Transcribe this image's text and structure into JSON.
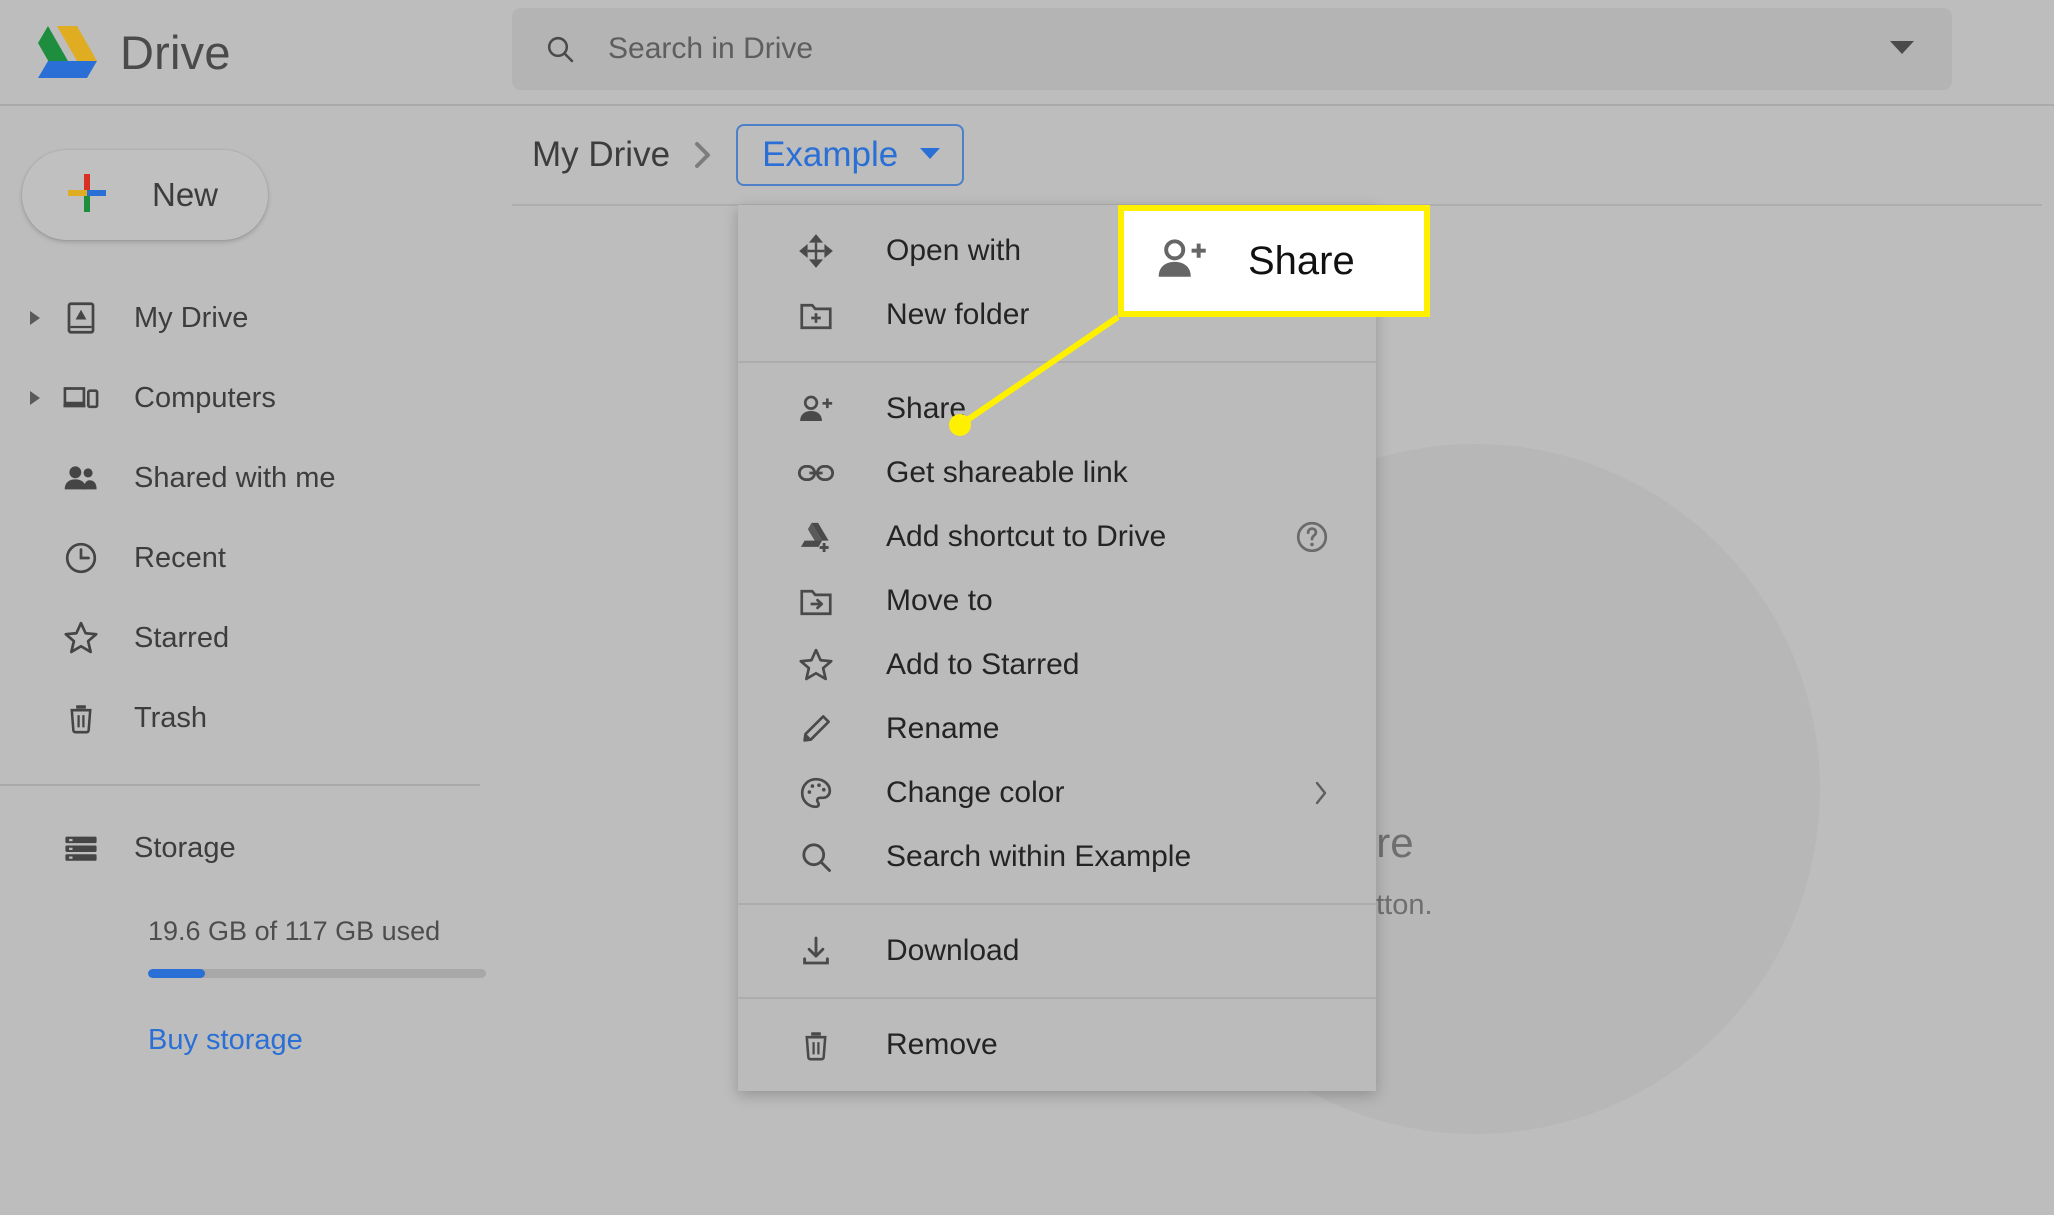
{
  "app": {
    "name": "Drive",
    "logo_colors": {
      "green": "#1e8e3e",
      "yellow": "#e0ac21",
      "blue": "#2a6fd6"
    }
  },
  "search": {
    "placeholder": "Search in Drive",
    "value": "",
    "icon": "search-icon",
    "options_icon": "chevron-down-icon"
  },
  "sidebar": {
    "new_button": {
      "label": "New",
      "icon": "plus-icon"
    },
    "items": [
      {
        "label": "My Drive",
        "icon": "drive-document-icon",
        "expandable": true
      },
      {
        "label": "Computers",
        "icon": "devices-icon",
        "expandable": true
      },
      {
        "label": "Shared with me",
        "icon": "people-icon",
        "expandable": false
      },
      {
        "label": "Recent",
        "icon": "clock-icon",
        "expandable": false
      },
      {
        "label": "Starred",
        "icon": "star-outline-icon",
        "expandable": false
      },
      {
        "label": "Trash",
        "icon": "trash-icon",
        "expandable": false
      }
    ],
    "storage": {
      "label": "Storage",
      "icon": "storage-icon",
      "used_text": "19.6 GB of 117 GB used",
      "used_percent": 17,
      "buy_link": "Buy storage",
      "bar_color": "#2a6fd6"
    }
  },
  "breadcrumb": {
    "root": "My Drive",
    "separator": "chevron-right-icon",
    "current": "Example",
    "current_caret": "caret-down-icon",
    "accent_color": "#2a6fd6"
  },
  "empty_state": {
    "title": "Drop files here",
    "subtitle": "or use the “New” button."
  },
  "context_menu": {
    "sections": [
      {
        "items": [
          {
            "label": "Open with",
            "icon": "move-arrows-icon",
            "trailing": null
          },
          {
            "label": "New folder",
            "icon": "folder-plus-icon",
            "trailing": null
          }
        ]
      },
      {
        "items": [
          {
            "label": "Share",
            "icon": "person-add-icon",
            "trailing": null
          },
          {
            "label": "Get shareable link",
            "icon": "link-icon",
            "trailing": null
          },
          {
            "label": "Add shortcut to Drive",
            "icon": "drive-add-icon",
            "trailing": "help-circle-icon"
          },
          {
            "label": "Move to",
            "icon": "folder-move-icon",
            "trailing": null
          },
          {
            "label": "Add to Starred",
            "icon": "star-outline-icon",
            "trailing": null
          },
          {
            "label": "Rename",
            "icon": "pencil-icon",
            "trailing": null
          },
          {
            "label": "Change color",
            "icon": "palette-icon",
            "trailing": "chevron-right-icon"
          },
          {
            "label": "Search within Example",
            "icon": "search-icon",
            "trailing": null
          }
        ]
      },
      {
        "items": [
          {
            "label": "Download",
            "icon": "download-icon",
            "trailing": null
          }
        ]
      },
      {
        "items": [
          {
            "label": "Remove",
            "icon": "trash-icon",
            "trailing": null
          }
        ]
      }
    ]
  },
  "callout": {
    "label": "Share",
    "icon": "person-add-icon",
    "border_color": "#fff000",
    "background": "#ffffff"
  }
}
